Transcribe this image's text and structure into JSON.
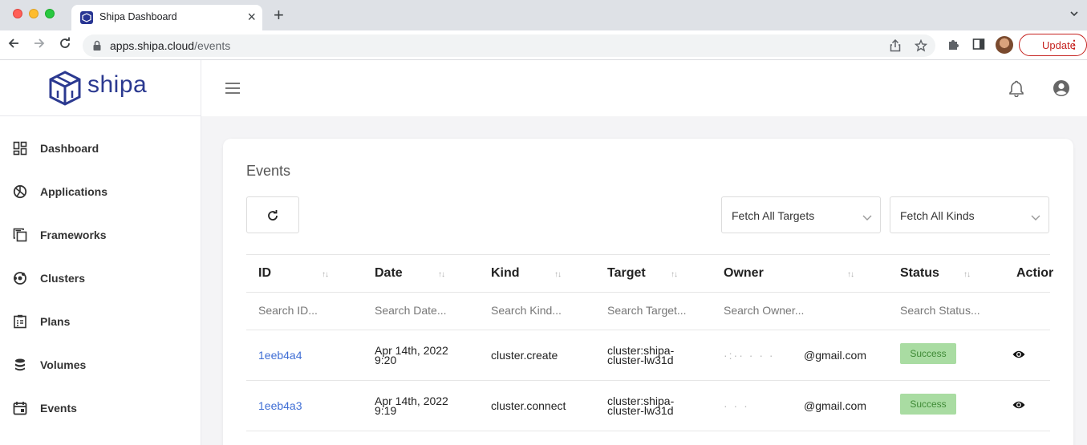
{
  "browser": {
    "tab_title": "Shipa Dashboard",
    "tab_close": "×",
    "new_tab": "+",
    "url_host": "apps.shipa.cloud",
    "url_path": "/events",
    "update_label": "Update",
    "update_menu": "⋮"
  },
  "brand": {
    "name": "shipa",
    "color": "#2b3990"
  },
  "sidebar": {
    "items": [
      {
        "label": "Dashboard",
        "icon": "dashboard-icon"
      },
      {
        "label": "Applications",
        "icon": "applications-icon"
      },
      {
        "label": "Frameworks",
        "icon": "frameworks-icon"
      },
      {
        "label": "Clusters",
        "icon": "clusters-icon"
      },
      {
        "label": "Plans",
        "icon": "plans-icon"
      },
      {
        "label": "Volumes",
        "icon": "volumes-icon"
      },
      {
        "label": "Events",
        "icon": "events-icon"
      }
    ]
  },
  "events": {
    "title": "Events",
    "filters": {
      "targets": "Fetch All Targets",
      "kinds": "Fetch All Kinds"
    },
    "columns": {
      "id": "ID",
      "date": "Date",
      "kind": "Kind",
      "target": "Target",
      "owner": "Owner",
      "status": "Status",
      "actions": "Actior"
    },
    "search": {
      "id": "Search ID...",
      "date": "Search Date...",
      "kind": "Search Kind...",
      "target": "Search Target...",
      "owner": "Search Owner...",
      "status": "Search Status..."
    },
    "rows": [
      {
        "id": "1eeb4a4",
        "date_line1": "Apr 14th, 2022",
        "date_line2": "9:20",
        "kind": "cluster.create",
        "target_line1": "cluster:shipa-",
        "target_line2": "cluster-lw31d",
        "owner_redacted": "·:·· ·  ·  ·",
        "owner_domain": "@gmail.com",
        "status": "Success"
      },
      {
        "id": "1eeb4a3",
        "date_line1": "Apr 14th, 2022",
        "date_line2": "9:19",
        "kind": "cluster.connect",
        "target_line1": "cluster:shipa-",
        "target_line2": "cluster-lw31d",
        "owner_redacted": "·     ·  ·",
        "owner_domain": "@gmail.com",
        "status": "Success"
      }
    ],
    "status_color": "#a9dca2"
  }
}
